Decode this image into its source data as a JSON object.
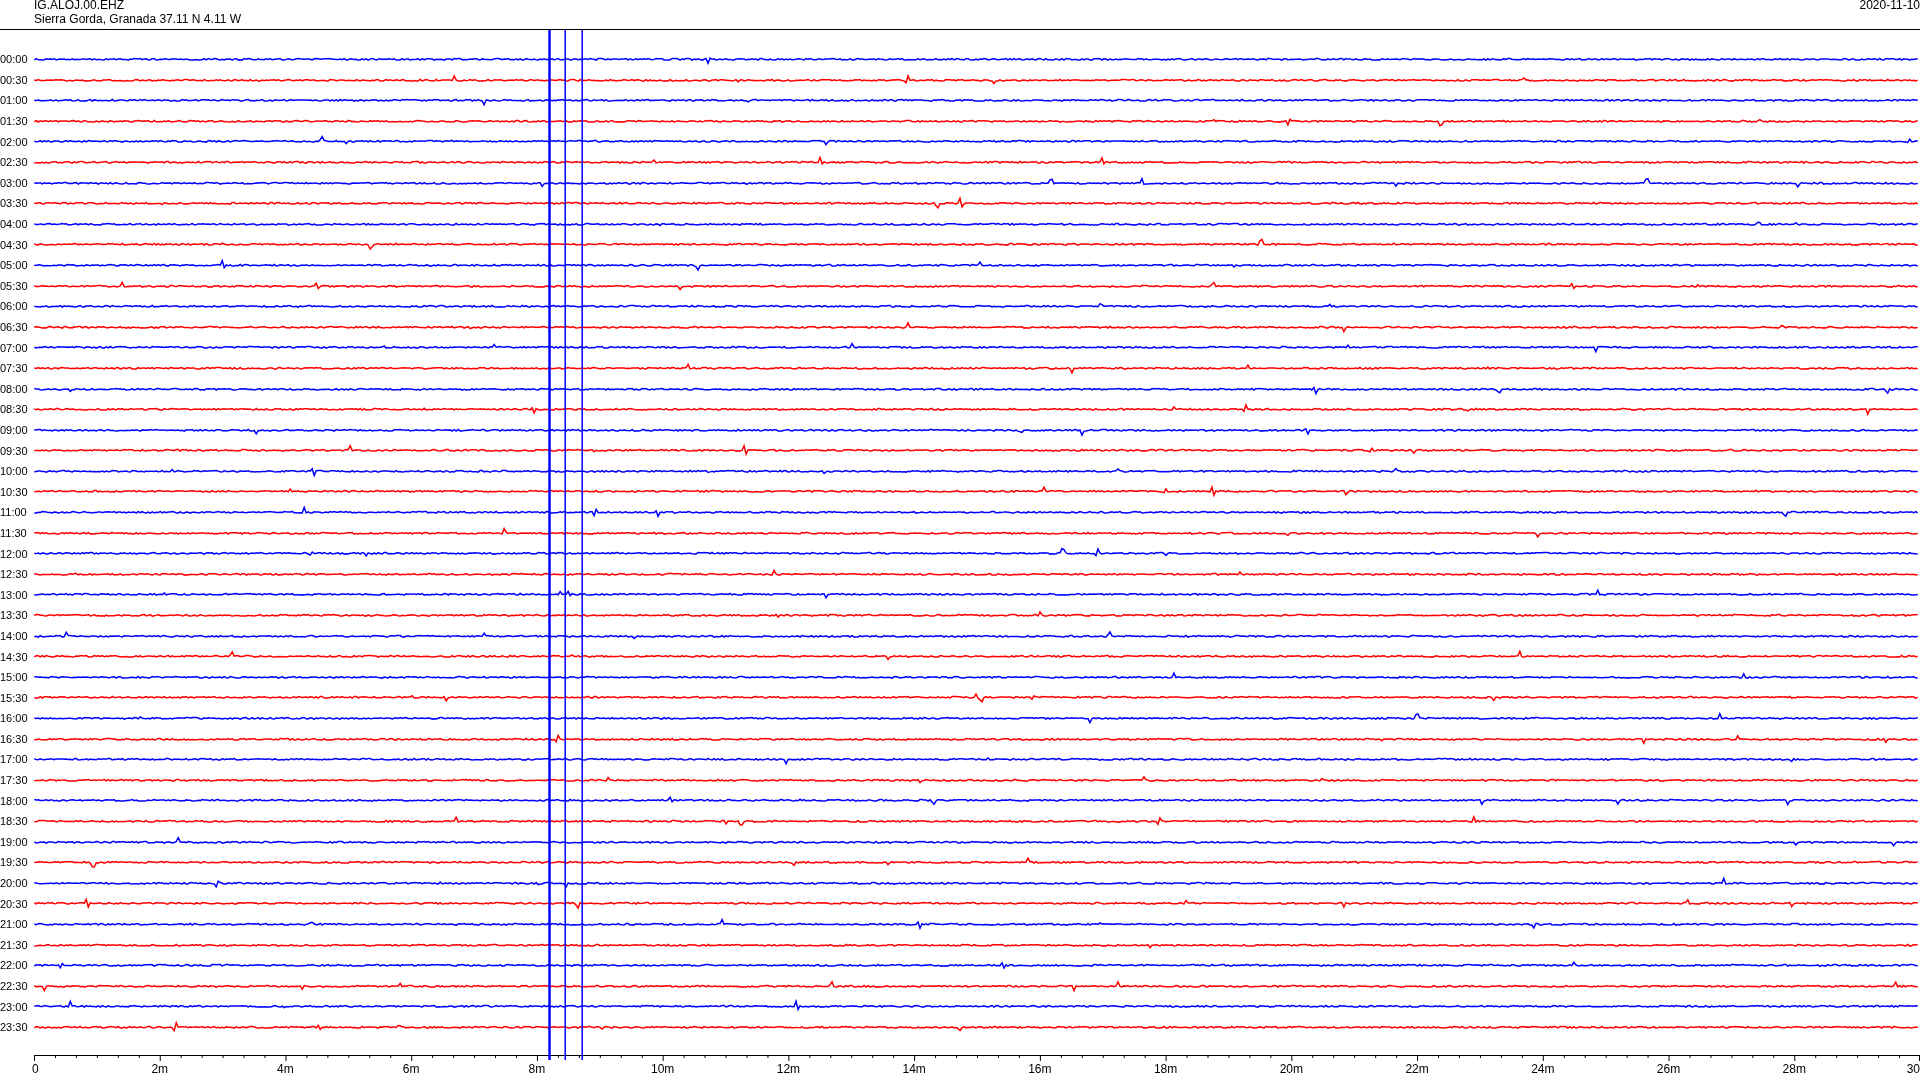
{
  "header": {
    "station": "IG.ALOJ.00.EHZ",
    "location": "Sierra Gorda, Granada  37.11 N 4.11 W",
    "date": "2020-11-10"
  },
  "rows": [
    {
      "label": "00:00",
      "color": "#0000ff"
    },
    {
      "label": "00:30",
      "color": "#ff0000"
    },
    {
      "label": "01:00",
      "color": "#0000ff"
    },
    {
      "label": "01:30",
      "color": "#ff0000"
    },
    {
      "label": "02:00",
      "color": "#0000ff"
    },
    {
      "label": "02:30",
      "color": "#ff0000"
    },
    {
      "label": "03:00",
      "color": "#0000ff"
    },
    {
      "label": "03:30",
      "color": "#ff0000"
    },
    {
      "label": "04:00",
      "color": "#0000ff"
    },
    {
      "label": "04:30",
      "color": "#ff0000"
    },
    {
      "label": "05:00",
      "color": "#0000ff"
    },
    {
      "label": "05:30",
      "color": "#ff0000"
    },
    {
      "label": "06:00",
      "color": "#0000ff"
    },
    {
      "label": "06:30",
      "color": "#ff0000"
    },
    {
      "label": "07:00",
      "color": "#0000ff"
    },
    {
      "label": "07:30",
      "color": "#ff0000"
    },
    {
      "label": "08:00",
      "color": "#0000ff"
    },
    {
      "label": "08:30",
      "color": "#ff0000"
    },
    {
      "label": "09:00",
      "color": "#0000ff"
    },
    {
      "label": "09:30",
      "color": "#ff0000"
    },
    {
      "label": "10:00",
      "color": "#0000ff"
    },
    {
      "label": "10:30",
      "color": "#ff0000"
    },
    {
      "label": "11:00",
      "color": "#0000ff"
    },
    {
      "label": "11:30",
      "color": "#ff0000"
    },
    {
      "label": "12:00",
      "color": "#0000ff"
    },
    {
      "label": "12:30",
      "color": "#ff0000"
    },
    {
      "label": "13:00",
      "color": "#0000ff"
    },
    {
      "label": "13:30",
      "color": "#ff0000"
    },
    {
      "label": "14:00",
      "color": "#0000ff"
    },
    {
      "label": "14:30",
      "color": "#ff0000"
    },
    {
      "label": "15:00",
      "color": "#0000ff"
    },
    {
      "label": "15:30",
      "color": "#ff0000"
    },
    {
      "label": "16:00",
      "color": "#0000ff"
    },
    {
      "label": "16:30",
      "color": "#ff0000"
    },
    {
      "label": "17:00",
      "color": "#0000ff"
    },
    {
      "label": "17:30",
      "color": "#ff0000"
    },
    {
      "label": "18:00",
      "color": "#0000ff"
    },
    {
      "label": "18:30",
      "color": "#ff0000"
    },
    {
      "label": "19:00",
      "color": "#0000ff"
    },
    {
      "label": "19:30",
      "color": "#ff0000"
    },
    {
      "label": "20:00",
      "color": "#0000ff"
    },
    {
      "label": "20:30",
      "color": "#ff0000"
    },
    {
      "label": "21:00",
      "color": "#0000ff"
    },
    {
      "label": "21:30",
      "color": "#ff0000"
    },
    {
      "label": "22:00",
      "color": "#0000ff"
    },
    {
      "label": "22:30",
      "color": "#ff0000"
    },
    {
      "label": "23:00",
      "color": "#0000ff"
    },
    {
      "label": "23:30",
      "color": "#ff0000"
    }
  ],
  "x_axis": {
    "ticks": [
      "0",
      "2m",
      "4m",
      "6m",
      "8m",
      "10m",
      "12m",
      "14m",
      "16m",
      "18m",
      "20m",
      "22m",
      "24m",
      "26m",
      "28m",
      "30"
    ]
  }
}
